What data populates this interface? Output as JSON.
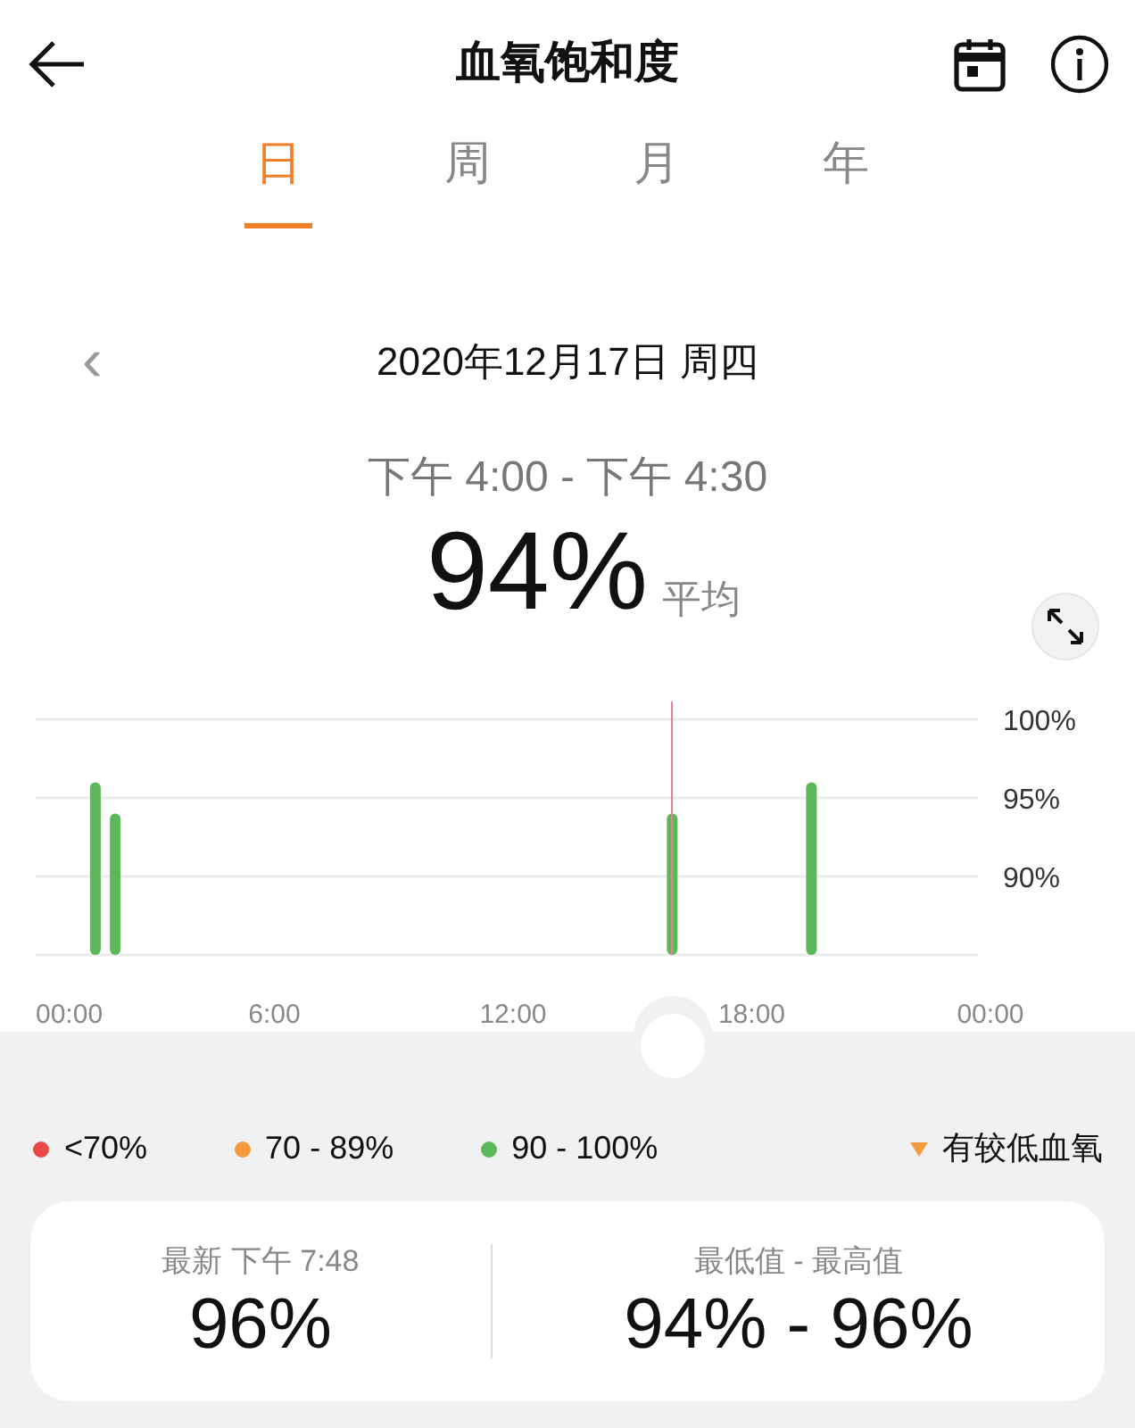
{
  "header": {
    "title": "血氧饱和度"
  },
  "tabs": [
    {
      "label": "日",
      "selected": true
    },
    {
      "label": "周",
      "selected": false
    },
    {
      "label": "月",
      "selected": false
    },
    {
      "label": "年",
      "selected": false
    }
  ],
  "date_nav": {
    "prev": "‹",
    "date": "2020年12月17日 周四"
  },
  "summary": {
    "time_range": "下午 4:00 - 下午 4:30",
    "value": "94%",
    "unit_label": "平均"
  },
  "chart": {
    "chart_data": {
      "type": "bar",
      "x": [
        1.5,
        2,
        16,
        19.5
      ],
      "values": [
        96,
        94,
        94,
        96
      ],
      "xlim": [
        0,
        24
      ],
      "ylim": [
        85,
        100
      ],
      "xticks": [
        {
          "value": 0,
          "label": "00:00"
        },
        {
          "value": 6,
          "label": "6:00"
        },
        {
          "value": 12,
          "label": "12:00"
        },
        {
          "value": 18,
          "label": "18:00"
        },
        {
          "value": 24,
          "label": "00:00"
        }
      ],
      "yticks": [
        {
          "value": 100,
          "label": "100%"
        },
        {
          "value": 95,
          "label": "95%"
        },
        {
          "value": 90,
          "label": "90%"
        }
      ]
    }
  },
  "legend": [
    {
      "label": "<70%",
      "color": "#e84a45",
      "kind": "dot"
    },
    {
      "label": "70 - 89%",
      "color": "#f39a3c",
      "kind": "dot"
    },
    {
      "label": "90 - 100%",
      "color": "#5cb85a",
      "kind": "dot"
    },
    {
      "label": "有较低血氧",
      "color": "#f39a3c",
      "kind": "triangle"
    }
  ],
  "stats": [
    {
      "label": "最新 下午 7:48",
      "value": "96%"
    },
    {
      "label": "最低值 - 最高值",
      "value": "94% - 96%"
    }
  ]
}
